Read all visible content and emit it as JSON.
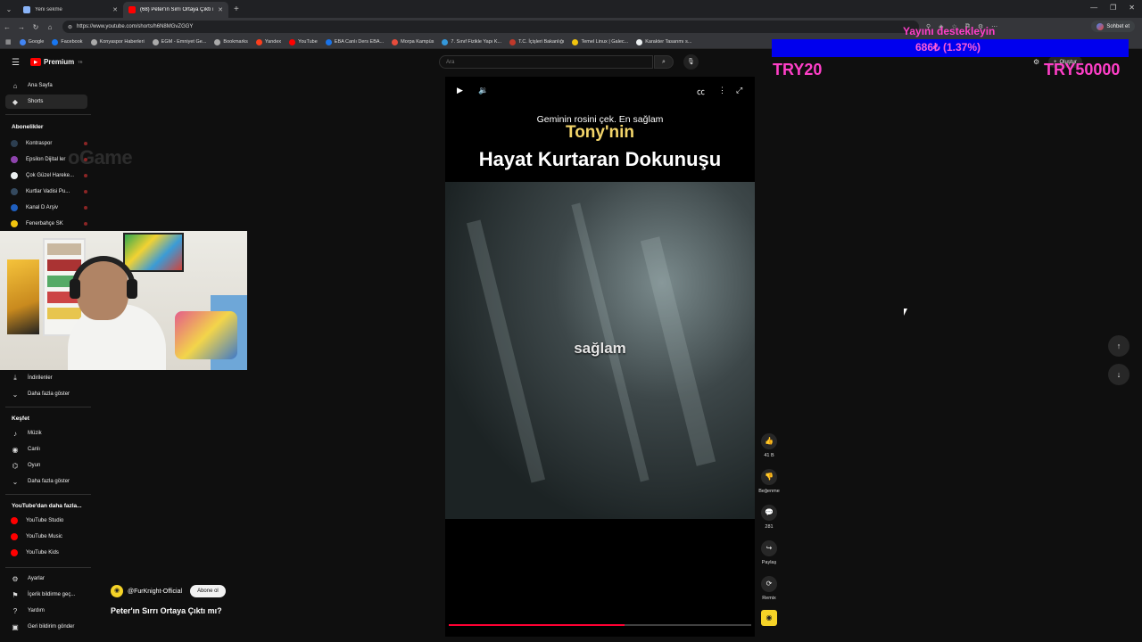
{
  "browser": {
    "tabs": [
      {
        "title": "Yeni sekme",
        "active": false,
        "favicon_color": "#8ab4f8"
      },
      {
        "title": "(68) Peter'ın Sırrı Ortaya Çıktı mı?",
        "active": true,
        "favicon_color": "#ff0000"
      }
    ],
    "url": "https://www.youtube.com/shorts/h6N8MGvZGGY",
    "profile_label": "Sohbet et",
    "bookmarks": [
      {
        "label": "Google",
        "color": "#4285f4"
      },
      {
        "label": "Facebook",
        "color": "#1877f2"
      },
      {
        "label": "Konyaspor Haberleri",
        "color": "#aaaaaa"
      },
      {
        "label": "EGM - Emniyet Ge...",
        "color": "#aaaaaa"
      },
      {
        "label": "Bookmarks",
        "color": "#aaaaaa"
      },
      {
        "label": "Yandex",
        "color": "#fc3f1d"
      },
      {
        "label": "YouTube",
        "color": "#ff0000"
      },
      {
        "label": "EBA Canlı Ders EBA...",
        "color": "#1a73e8"
      },
      {
        "label": "Morpa Kampüs",
        "color": "#e74c3c"
      },
      {
        "label": "7. Sınıf Fizikle Yapı K...",
        "color": "#3498db"
      },
      {
        "label": "T.C. İçişleri Bakanlığı",
        "color": "#c0392b"
      },
      {
        "label": "Temel Linux | Galec...",
        "color": "#f1c40f"
      },
      {
        "label": "Karakter Tasarımı s...",
        "color": "#ecf0f1"
      }
    ]
  },
  "youtube": {
    "logo_text": "Premium",
    "logo_sup": "TR",
    "search_placeholder": "Ara",
    "create_label": "Oluştur",
    "sidebar": {
      "top_items": [
        {
          "label": "Ana Sayfa",
          "icon": "home-icon",
          "glyph": "⌂"
        },
        {
          "label": "Shorts",
          "icon": "shorts-icon",
          "glyph": "◆"
        }
      ],
      "subs_heading": "Abonelikler",
      "subscriptions": [
        {
          "label": "Kontraspor",
          "color": "#2c3e50"
        },
        {
          "label": "Epsilon Dijital ler",
          "color": "#8e44ad"
        },
        {
          "label": "Çok Güzel Hareke...",
          "color": "#ecf0f1"
        },
        {
          "label": "Kurtlar Vadisi Pu...",
          "color": "#34495e"
        },
        {
          "label": "Kanal D Arşiv",
          "color": "#1f5fbf"
        },
        {
          "label": "Fenerbahçe SK",
          "color": "#f1c40f"
        }
      ],
      "you_items": [
        {
          "label": "İndirilenler",
          "icon": "download-icon",
          "glyph": "⤓"
        },
        {
          "label": "Daha fazla göster",
          "icon": "chevron-down-icon",
          "glyph": "⌄"
        }
      ],
      "explore_heading": "Keşfet",
      "explore_items": [
        {
          "label": "Müzik",
          "icon": "music-icon",
          "glyph": "♪"
        },
        {
          "label": "Canlı",
          "icon": "live-icon",
          "glyph": "◉"
        },
        {
          "label": "Oyun",
          "icon": "gaming-icon",
          "glyph": "⌬"
        },
        {
          "label": "Daha fazla göster",
          "icon": "chevron-down-icon",
          "glyph": "⌄"
        }
      ],
      "more_heading": "YouTube'dan daha fazla...",
      "more_items": [
        {
          "label": "YouTube Studio"
        },
        {
          "label": "YouTube Music"
        },
        {
          "label": "YouTube Kids"
        }
      ],
      "settings_items": [
        {
          "label": "Ayarlar",
          "icon": "gear-icon",
          "glyph": "⚙"
        },
        {
          "label": "İçerik bildirme geç...",
          "icon": "flag-icon",
          "glyph": "⚑"
        },
        {
          "label": "Yardım",
          "icon": "help-icon",
          "glyph": "?"
        },
        {
          "label": "Geri bildirim gönder",
          "icon": "feedback-icon",
          "glyph": "▣"
        }
      ]
    },
    "ghost_overlay_text": "oGame",
    "player": {
      "caption_top": "Geminin rosini çek. En sağlam",
      "title_yellow": "Tony'nin",
      "title_white": "Hayat Kurtaran Dokunuşu",
      "subtitle_word": "sağlam",
      "progress": 0.58
    },
    "actions": [
      {
        "name": "like",
        "glyph": "👍",
        "label": "41 B"
      },
      {
        "name": "dislike",
        "glyph": "👎",
        "label": "Beğenme"
      },
      {
        "name": "comments",
        "glyph": "💬",
        "label": "281"
      },
      {
        "name": "share",
        "glyph": "↪",
        "label": "Paylaş"
      },
      {
        "name": "remix",
        "glyph": "⟳",
        "label": "Remix"
      }
    ],
    "channel": {
      "name": "@FurKnight-Official",
      "subscribe_label": "Abone ol"
    },
    "video_title": "Peter'ın Sırrı Ortaya Çıktı mı?"
  },
  "overlay": {
    "donation_heading": "Yayını destekleyin",
    "donation_amount": "686₺ (1.37%)",
    "try_left": "TRY20",
    "try_right": "TRY50000",
    "bar_color": "#0000ee",
    "text_color": "#ff3fc8"
  }
}
